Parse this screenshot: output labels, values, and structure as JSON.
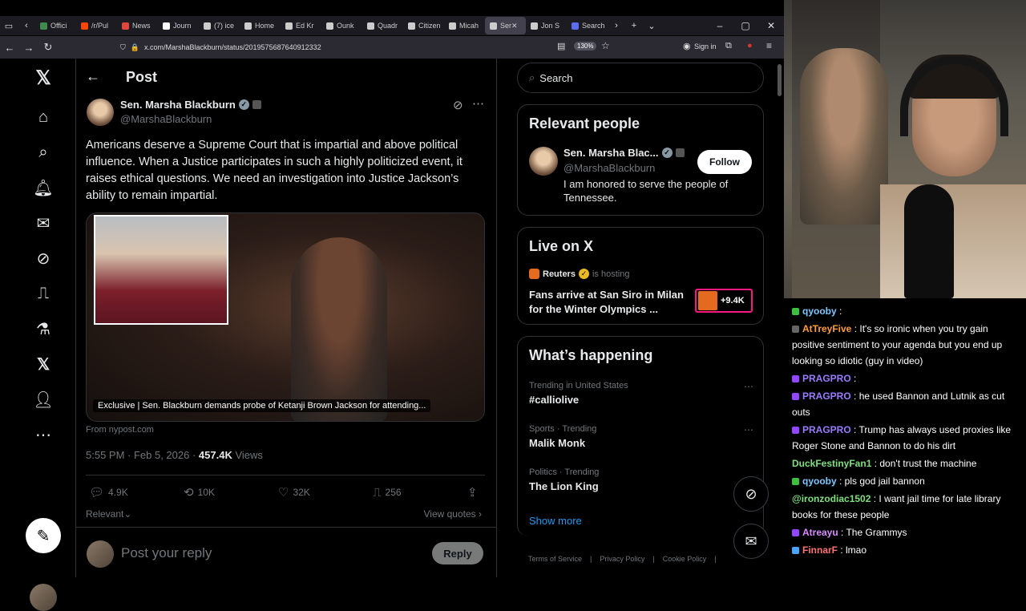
{
  "browser": {
    "tabs": [
      {
        "label": "Offici",
        "color": "#3f8a4e"
      },
      {
        "label": "/r/Pul",
        "color": "#ff4500"
      },
      {
        "label": "News",
        "color": "#e0463b"
      },
      {
        "label": "Journ",
        "color": "#ffffff"
      },
      {
        "label": "(7) ice",
        "color": "#cccccc"
      },
      {
        "label": "Home",
        "color": "#cccccc"
      },
      {
        "label": "Ed Kr",
        "color": "#cccccc"
      },
      {
        "label": "Ounk",
        "color": "#cccccc"
      },
      {
        "label": "Quadr",
        "color": "#cccccc"
      },
      {
        "label": "Citizen",
        "color": "#cccccc"
      },
      {
        "label": "Micah",
        "color": "#cccccc"
      },
      {
        "label": "Ser",
        "color": "#cccccc"
      },
      {
        "label": "Jon S",
        "color": "#cccccc"
      },
      {
        "label": "Search",
        "color": "#5b6cf0"
      }
    ],
    "url": "x.com/MarshaBlackburn/status/2019575687640912332",
    "zoom": "130%",
    "sign_in": "Sign in"
  },
  "post": {
    "header": "Post",
    "author_name": "Sen. Marsha Blackburn",
    "author_handle": "@MarshaBlackburn",
    "text": "Americans deserve a Supreme Court that is impartial and above political influence. When a Justice participates in such a highly politicized event, it raises ethical questions. We need an investigation into Justice Jackson’s ability to remain impartial.",
    "card_caption": "Exclusive | Sen. Blackburn demands probe of Ketanji Brown Jackson for attending...",
    "card_source": "From nypost.com",
    "time": "5:55 PM · Feb 5, 2026 · ",
    "views_count": "457.4K",
    "views_label": " Views",
    "replies": "4.9K",
    "reposts": "10K",
    "likes": "32K",
    "bookmarks": "256",
    "relevant": "Relevant",
    "view_quotes": "View quotes",
    "reply_placeholder": "Post your reply",
    "reply_button": "Reply"
  },
  "right": {
    "search_placeholder": "Search",
    "relevant_title": "Relevant people",
    "rp_name": "Sen. Marsha Blac...",
    "rp_handle": "@MarshaBlackburn",
    "rp_bio": "I am honored to serve the people of Tennessee.",
    "follow": "Follow",
    "live_title": "Live on X",
    "live_host": "Reuters",
    "live_hosting": "is hosting",
    "live_text": "Fans arrive at San Siro in Milan for the Winter Olympics ...",
    "live_count": "+9.4K",
    "happening_title": "What’s happening",
    "trends": [
      {
        "category": "Trending in United States",
        "name": "#calliolive"
      },
      {
        "category": "Sports · Trending",
        "name": "Malik Monk"
      },
      {
        "category": "Politics · Trending",
        "name": "The Lion King"
      }
    ],
    "show_more": "Show more",
    "footer": [
      "Terms of Service",
      "Privacy Policy",
      "Cookie Policy"
    ]
  },
  "chat": [
    {
      "user": "qyooby",
      "text": " : ",
      "color": "#7ec8ff",
      "badge": "#3fbf3f"
    },
    {
      "user": "AtTreyFive",
      "text": " : It's so ironic when you try gain positive sentiment to your agenda but you end up looking so idiotic (guy in video)",
      "color": "#ff9d3c",
      "badge": "#666666"
    },
    {
      "user": "PRAGPRO",
      "text": " : ",
      "color": "#9b7bff",
      "badge": "#9146ff"
    },
    {
      "user": "PRAGPRO",
      "text": " : he used Bannon and Lutnik as cut outs",
      "color": "#9b7bff",
      "badge": "#9146ff"
    },
    {
      "user": "PRAGPRO",
      "text": " : Trump has always used proxies like Roger Stone and Bannon to do his dirt",
      "color": "#9b7bff",
      "badge": "#9146ff"
    },
    {
      "user": "DuckFestinyFan1",
      "text": " : don't trust the machine",
      "color": "#7fe07f",
      "badge": ""
    },
    {
      "user": "qyooby",
      "text": " : pls god jail bannon",
      "color": "#7ec8ff",
      "badge": "#3fbf3f"
    },
    {
      "user": "@ironzodiac1502",
      "text": " : I want jail time for late library books for these people",
      "color": "#7fe07f",
      "badge": ""
    },
    {
      "user": "Atreayu",
      "text": " : The Grammys",
      "color": "#d98cff",
      "badge": "#9146ff"
    },
    {
      "user": "FinnarF",
      "text": " : lmao",
      "color": "#ff7373",
      "badge": "#4aa3ff"
    }
  ]
}
